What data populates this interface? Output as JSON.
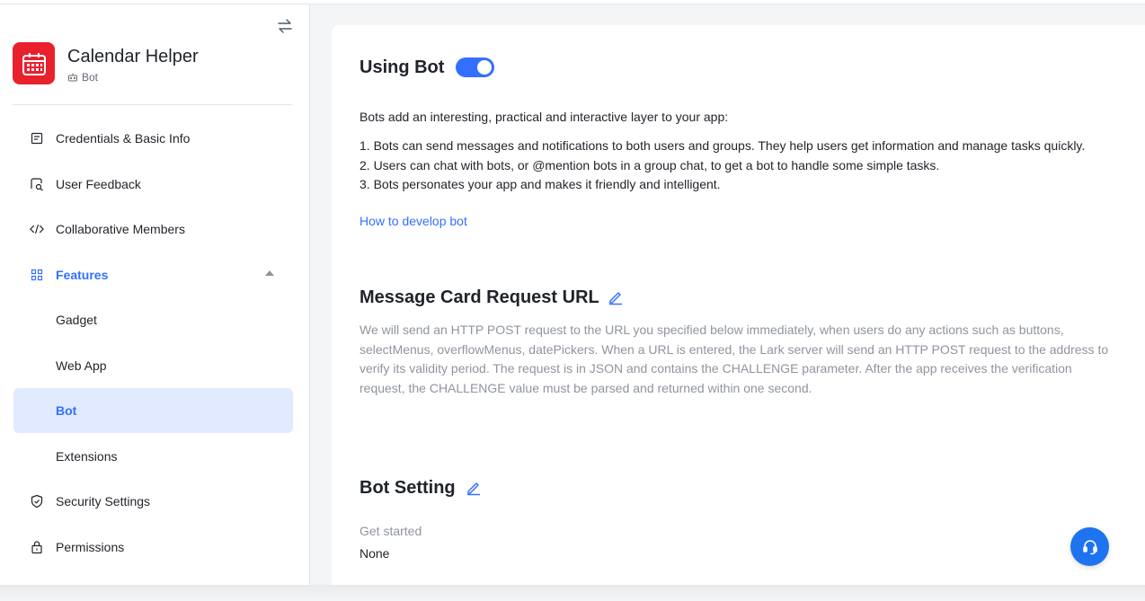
{
  "app": {
    "name": "Calendar Helper",
    "type": "Bot"
  },
  "sidebar": {
    "items": [
      {
        "label": "Credentials & Basic Info",
        "icon": "document-icon"
      },
      {
        "label": "User Feedback",
        "icon": "feedback-icon"
      },
      {
        "label": "Collaborative Members",
        "icon": "code-icon"
      },
      {
        "label": "Features",
        "icon": "grid-icon"
      },
      {
        "label": "Gadget"
      },
      {
        "label": "Web App"
      },
      {
        "label": "Bot"
      },
      {
        "label": "Extensions"
      },
      {
        "label": "Security Settings",
        "icon": "shield-icon"
      },
      {
        "label": "Permissions",
        "icon": "lock-icon"
      }
    ]
  },
  "main": {
    "using_bot": {
      "title": "Using Bot",
      "enabled": true
    },
    "intro": "Bots add an interesting, practical and interactive layer to your app:",
    "points": [
      "1. Bots can send messages and notifications to both users and groups. They help users get information and manage tasks quickly.",
      "2. Users can chat with bots, or @mention bots in a group chat, to get a bot to handle some simple tasks.",
      "3. Bots personates your app and makes it friendly and intelligent."
    ],
    "link": "How to develop bot",
    "message_card": {
      "title": "Message Card Request URL",
      "description": "We will send an HTTP POST request to the URL you specified below immediately, when users do any actions such as buttons, selectMenus, overflowMenus, datePickers. When a URL is entered, the Lark server will send an HTTP POST request to the address to verify its validity period. The request is in JSON and contains the CHALLENGE parameter. After the app receives the verification request, the CHALLENGE value must be parsed and returned within one second."
    },
    "bot_setting": {
      "title": "Bot Setting",
      "get_started_label": "Get started",
      "get_started_value": "None"
    }
  },
  "colors": {
    "accent": "#3370ff",
    "app_icon": "#e8212c",
    "selected_bg": "#e1eaff"
  }
}
